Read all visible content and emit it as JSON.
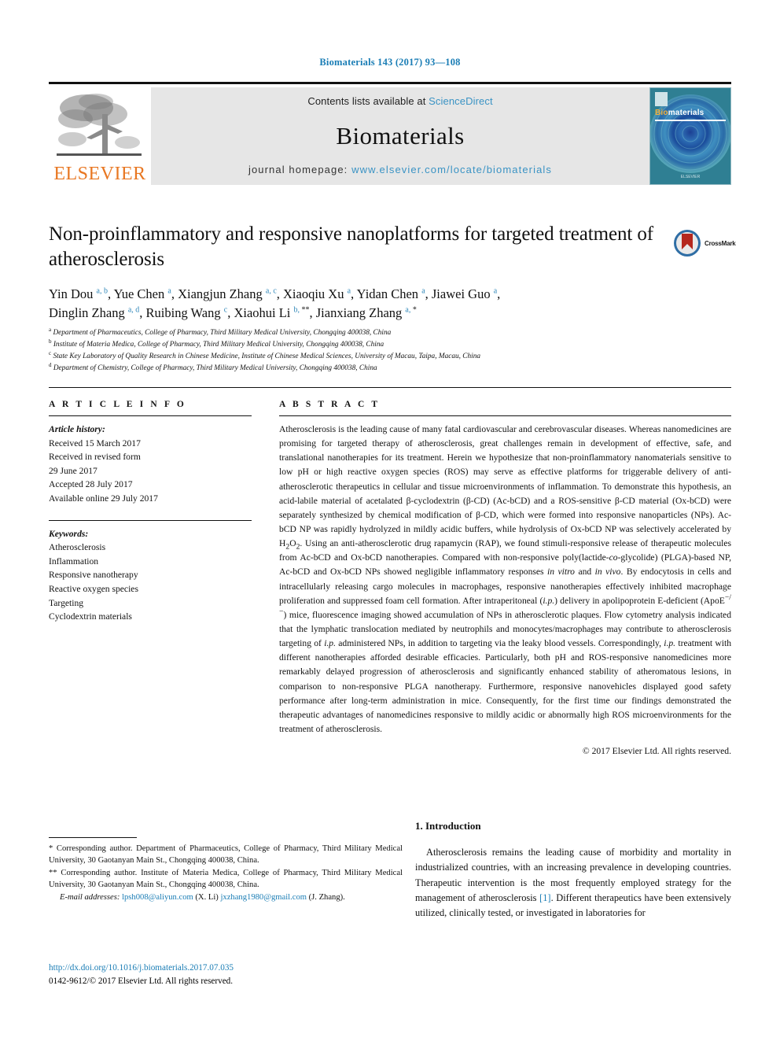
{
  "running_head": "Biomaterials 143 (2017) 93—108",
  "masthead": {
    "publisher_name": "ELSEVIER",
    "contents_prefix": "Contents lists available at ",
    "contents_link": "ScienceDirect",
    "journal_name": "Biomaterials",
    "homepage_prefix": "journal homepage: ",
    "homepage_url": "www.elsevier.com/locate/biomaterials",
    "cover": {
      "title_part1": "Bio",
      "title_part2": "materials",
      "bottom_text": "ELSEVIER"
    },
    "link_color": "#3a93c4",
    "band_color": "#e6e6e6"
  },
  "crossmark": {
    "label": "CrossMark"
  },
  "article": {
    "title": "Non-proinflammatory and responsive nanoplatforms for targeted treatment of atherosclerosis",
    "authors_line1": "Yin Dou a, b, Yue Chen a, Xiangjun Zhang a, c, Xiaoqiu Xu a, Yidan Chen a, Jiawei Guo a,",
    "authors_line2": "Dinglin Zhang a, d, Ruibing Wang c, Xiaohui Li b, **, Jianxiang Zhang a, *",
    "affiliations": [
      {
        "marker": "a",
        "text": "Department of Pharmaceutics, College of Pharmacy, Third Military Medical University, Chongqing 400038, China"
      },
      {
        "marker": "b",
        "text": "Institute of Materia Medica, College of Pharmacy, Third Military Medical University, Chongqing 400038, China"
      },
      {
        "marker": "c",
        "text": "State Key Laboratory of Quality Research in Chinese Medicine, Institute of Chinese Medical Sciences, University of Macau, Taipa, Macau, China"
      },
      {
        "marker": "d",
        "text": "Department of Chemistry, College of Pharmacy, Third Military Medical University, Chongqing 400038, China"
      }
    ]
  },
  "article_info": {
    "heading": "A R T I C L E  I N F O",
    "history_label": "Article history:",
    "history_lines": [
      "Received 15 March 2017",
      "Received in revised form",
      "29 June 2017",
      "Accepted 28 July 2017",
      "Available online 29 July 2017"
    ],
    "keywords_label": "Keywords:",
    "keywords": [
      "Atherosclerosis",
      "Inflammation",
      "Responsive nanotherapy",
      "Reactive oxygen species",
      "Targeting",
      "Cyclodextrin materials"
    ]
  },
  "abstract": {
    "heading": "A B S T R A C T",
    "copyright": "© 2017 Elsevier Ltd. All rights reserved."
  },
  "footnotes": {
    "corr1": "* Corresponding author. Department of Pharmaceutics, College of Pharmacy, Third Military Medical University, 30 Gaotanyan Main St., Chongqing 400038, China.",
    "corr2": "** Corresponding author. Institute of Materia Medica, College of Pharmacy, Third Military Medical University, 30 Gaotanyan Main St., Chongqing 400038, China.",
    "email_label": "E-mail addresses:",
    "email1": "lpsh008@aliyun.com",
    "email1_owner": "(X. Li)",
    "email2": "jxzhang1980@gmail.com",
    "email2_owner": "(J. Zhang).",
    "doi_url": "http://dx.doi.org/10.1016/j.biomaterials.2017.07.035",
    "issn_line": "0142-9612/© 2017 Elsevier Ltd. All rights reserved."
  },
  "introduction": {
    "number": "1.",
    "heading": "1.  Introduction",
    "ref_marker": "[1]"
  }
}
